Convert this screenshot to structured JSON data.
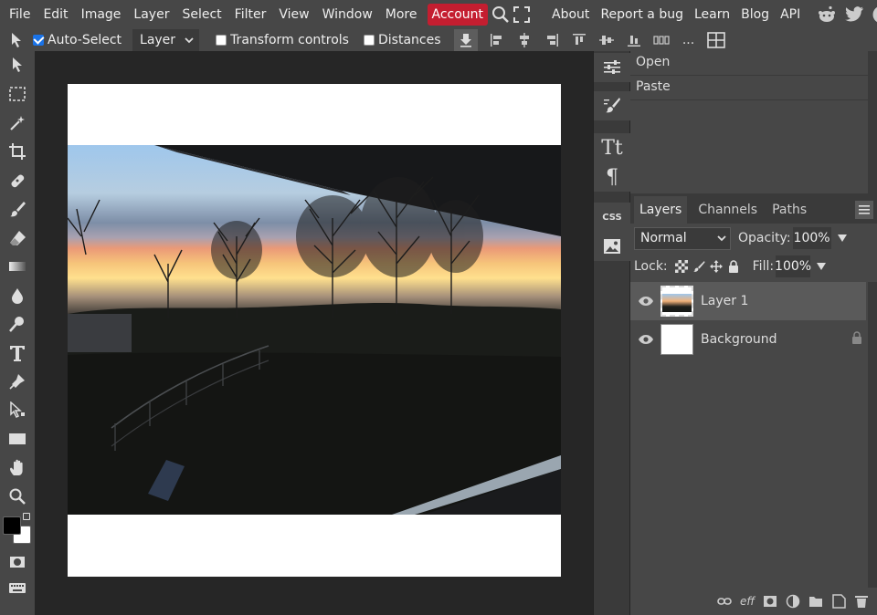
{
  "menu": {
    "items": [
      "File",
      "Edit",
      "Image",
      "Layer",
      "Select",
      "Filter",
      "View",
      "Window",
      "More"
    ],
    "account_label": "Account",
    "right_links": [
      "About",
      "Report a bug",
      "Learn",
      "Blog",
      "API"
    ],
    "icons": [
      "search-icon",
      "fullscreen-icon",
      "reddit-icon",
      "twitter-icon",
      "facebook-icon"
    ]
  },
  "options": {
    "auto_select_label": "Auto-Select",
    "auto_select_checked": true,
    "target_select_value": "Layer",
    "transform_controls_label": "Transform controls",
    "distances_label": "Distances",
    "more_label": "..."
  },
  "toolbox": {
    "tools": [
      "move-tool-icon",
      "marquee-tool-icon",
      "magic-wand-icon",
      "crop-tool-icon",
      "healing-brush-icon",
      "brush-tool-icon",
      "eraser-tool-icon",
      "gradient-tool-icon",
      "blur-tool-icon",
      "dodge-tool-icon",
      "type-tool-icon",
      "pen-tool-icon",
      "path-select-icon",
      "shape-tool-icon",
      "hand-tool-icon",
      "zoom-tool-icon"
    ],
    "foreground_color": "#000000",
    "background_color": "#ffffff"
  },
  "sidestrip": {
    "css_label": "CSS"
  },
  "history": {
    "items": [
      "Open",
      "Paste"
    ]
  },
  "layers_panel": {
    "tabs": [
      "Layers",
      "Channels",
      "Paths"
    ],
    "active_tab": "Layers",
    "blend_mode": "Normal",
    "opacity_label": "Opacity:",
    "opacity_value": "100%",
    "lock_label": "Lock:",
    "fill_label": "Fill:",
    "fill_value": "100%",
    "layers": [
      {
        "name": "Layer 1",
        "selected": true,
        "locked": false
      },
      {
        "name": "Background",
        "selected": false,
        "locked": true
      }
    ],
    "footer_fx_label": "eff"
  },
  "colors": {
    "accent_red": "#c41e30",
    "panel_bg": "#474747",
    "workspace_bg": "#262626"
  }
}
